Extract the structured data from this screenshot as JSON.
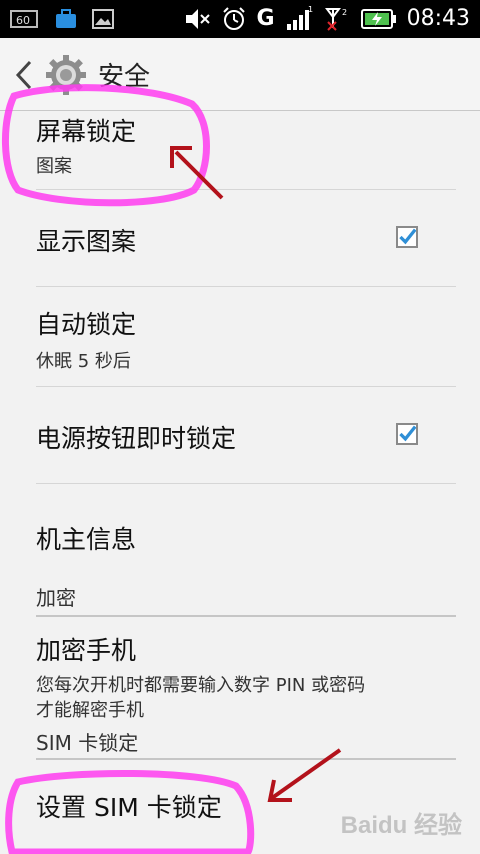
{
  "status_bar": {
    "battery_small": "60",
    "time": "08:43",
    "network": "G",
    "sim1": "1",
    "sim2": "2"
  },
  "header": {
    "title": "安全"
  },
  "items": {
    "screen_lock": {
      "title": "屏幕锁定",
      "sub": "图案"
    },
    "show_pattern": {
      "title": "显示图案",
      "checked": true
    },
    "auto_lock": {
      "title": "自动锁定",
      "sub": "休眠 5 秒后"
    },
    "power_lock": {
      "title": "电源按钮即时锁定",
      "checked": true
    },
    "owner_info": {
      "title": "机主信息"
    },
    "encrypt_phone": {
      "title": "加密手机",
      "sub": "您每次开机时都需要输入数字 PIN 或密码\n才能解密手机"
    },
    "set_sim_lock": {
      "title": "设置 SIM 卡锁定"
    }
  },
  "sections": {
    "encryption": "加密",
    "sim_lock": "SIM 卡锁定"
  },
  "watermark": {
    "text": "Baidu 经验"
  },
  "colors": {
    "accent_check": "#2f8fd6",
    "highlight": "#ff3cf0",
    "arrow": "#b3121b"
  }
}
